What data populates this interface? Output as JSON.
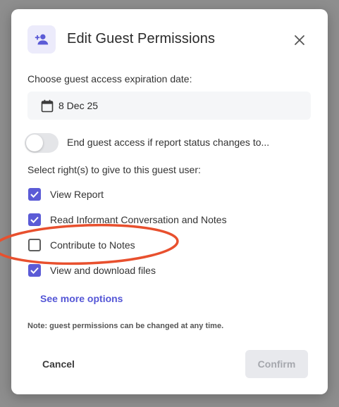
{
  "dialog": {
    "title": "Edit Guest Permissions",
    "header_icon": "add-person-icon",
    "close_icon": "close-icon"
  },
  "expiration": {
    "label": "Choose guest access expiration date:",
    "date_value": "8 Dec 25",
    "icon": "calendar-icon"
  },
  "status_toggle": {
    "label": "End guest access if report status changes to...",
    "on": false
  },
  "rights": {
    "label": "Select right(s) to give to this guest user:",
    "items": [
      {
        "label": "View Report",
        "checked": true
      },
      {
        "label": "Read Informant Conversation and Notes",
        "checked": true
      },
      {
        "label": "Contribute to Notes",
        "checked": false
      },
      {
        "label": "View and download files",
        "checked": true
      }
    ],
    "see_more": "See more options"
  },
  "note": "Note: guest permissions can be changed at any time.",
  "footer": {
    "cancel_label": "Cancel",
    "confirm_label": "Confirm",
    "confirm_disabled": true
  },
  "colors": {
    "accent": "#5b5bd6",
    "annotation": "#e8502e"
  }
}
